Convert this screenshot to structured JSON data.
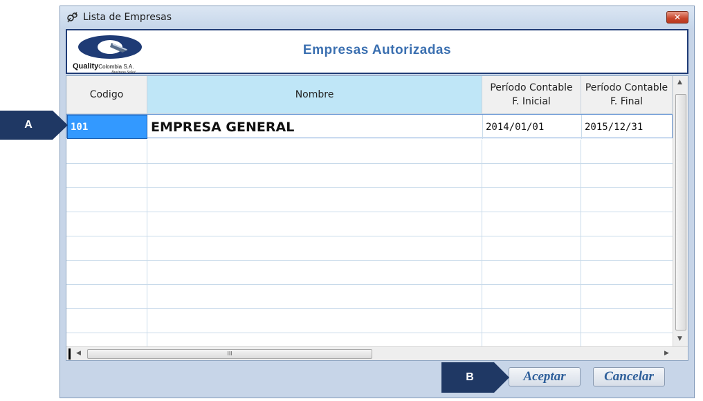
{
  "window": {
    "title": "Lista de Empresas",
    "close_glyph": "✕"
  },
  "header": {
    "logo_brand": "Quality",
    "logo_sub": "Colombia S.A.",
    "logo_tagline": "Business Solut.",
    "title": "Empresas  Autorizadas"
  },
  "grid": {
    "columns": [
      {
        "line1": "Codigo",
        "line2": ""
      },
      {
        "line1": "Nombre",
        "line2": ""
      },
      {
        "line1": "Período  Contable",
        "line2": "F. Inicial"
      },
      {
        "line1": "Período  Contable",
        "line2": "F. Final"
      }
    ],
    "rows": [
      {
        "codigo": "101",
        "nombre": "EMPRESA GENERAL",
        "f_inicial": "2014/01/01",
        "f_final": "2015/12/31"
      }
    ],
    "hscroll_grip": "III"
  },
  "buttons": {
    "aceptar": "Aceptar",
    "cancelar": "Cancelar"
  },
  "callouts": {
    "a": "A",
    "b": "B"
  },
  "colors": {
    "callout": "#1f3864",
    "header_title": "#3a6fb0",
    "selected_cell": "#3399ff"
  }
}
